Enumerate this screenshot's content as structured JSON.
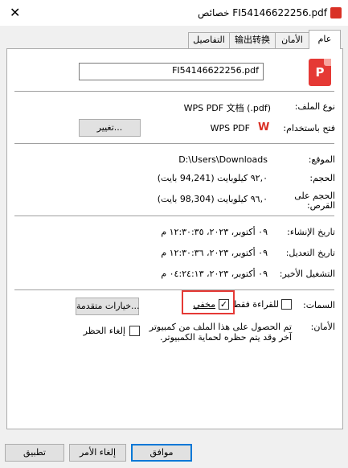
{
  "window": {
    "title": "FI54146622256.pdf خصائص",
    "close_glyph": "✕"
  },
  "tabs": [
    {
      "label": "عام",
      "active": true
    },
    {
      "label": "الأمان",
      "active": false
    },
    {
      "label": "输出转换",
      "active": false
    },
    {
      "label": "التفاصيل",
      "active": false
    }
  ],
  "file": {
    "name": "FI54146622256.pdf",
    "icon": "pdf-icon"
  },
  "type_row": {
    "label": "نوع الملف:",
    "value": "WPS PDF 文档 (.pdf)"
  },
  "opens_with": {
    "label": "فتح باستخدام:",
    "app": "WPS PDF",
    "change_button": "تغيير..."
  },
  "location": {
    "label": "الموقع:",
    "value": "D:\\Users\\Downloads"
  },
  "size": {
    "label": "الحجم:",
    "value": "٩٢,٠ كيلوبايت (94,241 بايت)"
  },
  "size_on_disk": {
    "label": "الحجم على القرص:",
    "value": "٩٦,٠ كيلوبايت (98,304 بايت)"
  },
  "created": {
    "label": "تاريخ الإنشاء:",
    "value": "٠٩ أكتوبر، ٢٠٢٣، ١٢:٣٠:٣٥ م"
  },
  "modified": {
    "label": "تاريخ التعديل:",
    "value": "٠٩ أكتوبر، ٢٠٢٣، ١٢:٣٠:٣٦ م"
  },
  "accessed": {
    "label": "التشغيل الأخير:",
    "value": "٠٩ أكتوبر، ٢٠٢٣، ٠٤:٢٤:١٣ م"
  },
  "attributes": {
    "label": "السمات:",
    "readonly_label": "للقراءة فقط",
    "readonly_checked": false,
    "hidden_label": "مخفي",
    "hidden_checked": true,
    "advanced_button": "خيارات متقدمة..."
  },
  "security": {
    "label": "الأمان:",
    "message_line1": "تم الحصول على هذا الملف من كمبيوتر",
    "message_line2": "آخر وقد يتم حظره لحماية الكمبيوتر.",
    "unblock_label": "إلغاء الحظر",
    "unblock_checked": false
  },
  "buttons": {
    "ok": "موافق",
    "cancel": "إلغاء الأمر",
    "apply": "تطبيق"
  },
  "colors": {
    "accent": "#0078d7",
    "highlight": "#e53935",
    "pdf_red": "#e53935"
  }
}
